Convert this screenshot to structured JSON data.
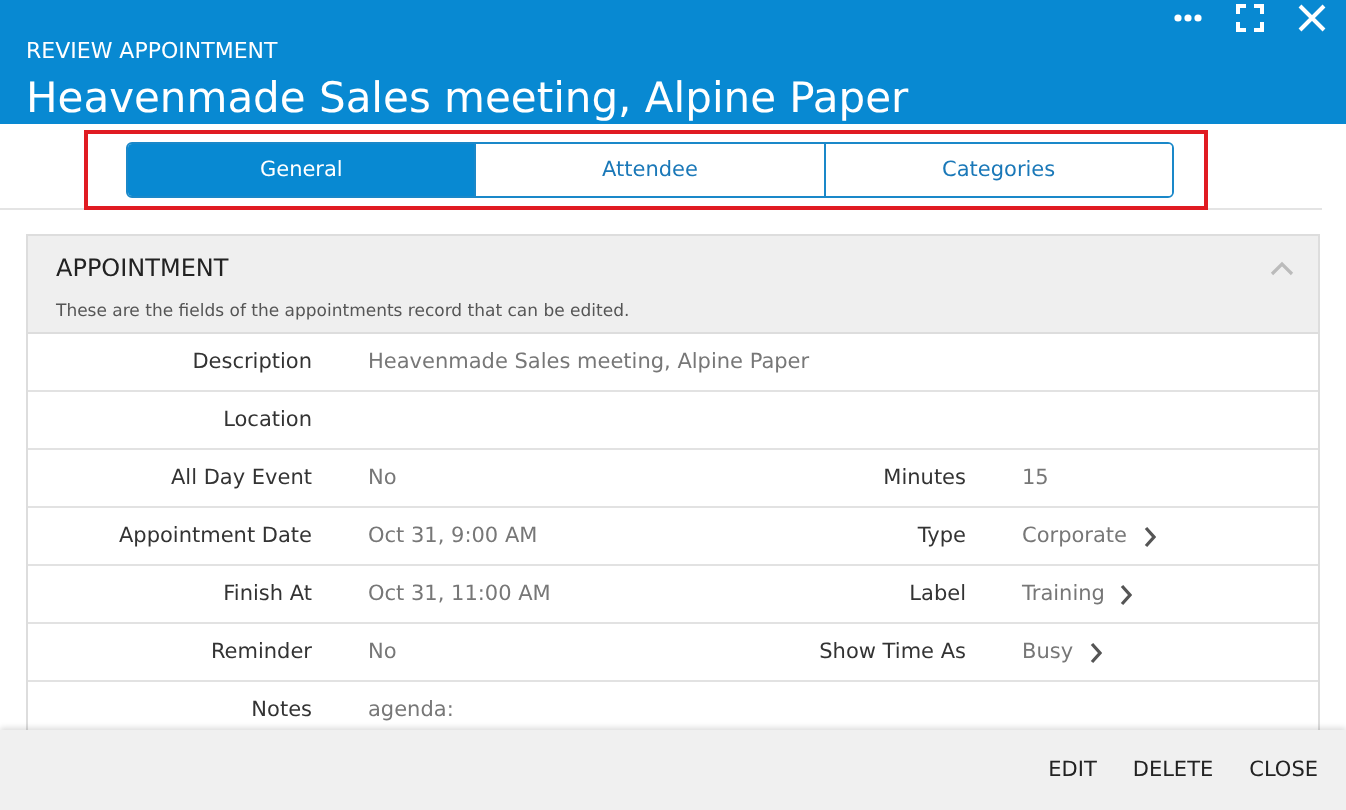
{
  "window": {
    "subtitle": "REVIEW APPOINTMENT",
    "title": "Heavenmade Sales meeting, Alpine Paper",
    "controls": [
      {
        "kind": "more"
      },
      {
        "kind": "expand"
      },
      {
        "kind": "close"
      }
    ]
  },
  "tabs_highlighted": true,
  "tabs": [
    {
      "label": "General",
      "selected": true
    },
    {
      "label": "Attendee",
      "selected": false
    },
    {
      "label": "Categories",
      "selected": false
    }
  ],
  "section": {
    "title": "APPOINTMENT",
    "expanded": true,
    "caption": "These are the fields of the appointments record that can be edited.",
    "rows": [
      {
        "label": "Description",
        "value": "Heavenmade Sales meeting, Alpine Paper"
      },
      {
        "label": "Location"
      },
      {
        "label": "All Day Event",
        "value": "No",
        "label_2": "Minutes",
        "value_2": "15",
        "link_2": false
      },
      {
        "label": "Appointment Date",
        "value": "Oct 31, 9:00 AM",
        "label_2": "Type",
        "value_2": "Corporate",
        "link_2": true
      },
      {
        "label": "Finish At",
        "value": "Oct 31, 11:00 AM",
        "label_2": "Label",
        "value_2": "Training",
        "link_2": true
      },
      {
        "label": "Reminder",
        "value": "No",
        "label_2": "Show Time As",
        "value_2": "Busy",
        "link_2": true
      },
      {
        "label": "Notes",
        "value": "agenda:"
      }
    ]
  },
  "footer_buttons": [
    "EDIT",
    "DELETE",
    "CLOSE"
  ]
}
